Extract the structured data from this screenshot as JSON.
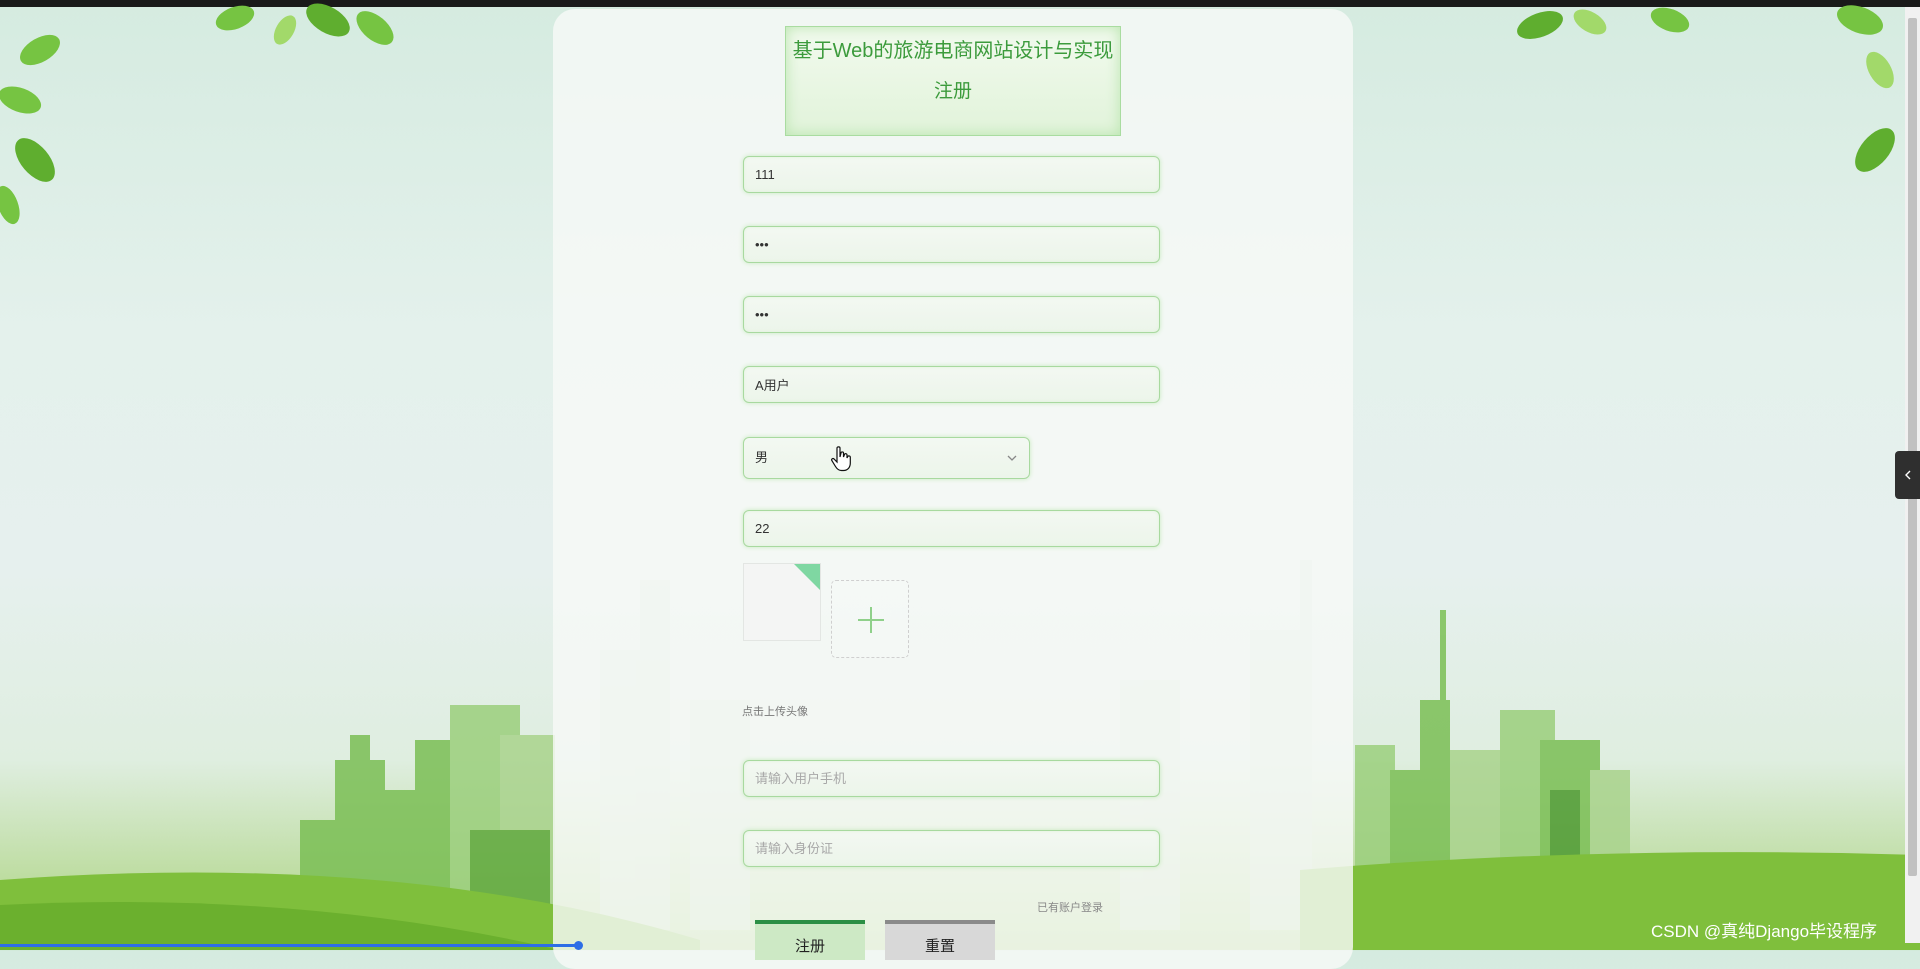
{
  "title": {
    "line1": "基于Web的旅游电商网站设计与实现",
    "line2": "注册"
  },
  "form": {
    "account": {
      "value": "111",
      "placeholder": ""
    },
    "password": {
      "value": "111",
      "placeholder": ""
    },
    "confirm_password": {
      "value": "111",
      "placeholder": ""
    },
    "username": {
      "value": "A用户",
      "placeholder": ""
    },
    "gender": {
      "selected": "男"
    },
    "age": {
      "value": "22",
      "placeholder": ""
    },
    "avatar_tip": "点击上传头像",
    "phone": {
      "value": "",
      "placeholder": "请输入用户手机"
    },
    "id_card": {
      "value": "",
      "placeholder": "请输入身份证"
    }
  },
  "links": {
    "login": "已有账户登录"
  },
  "buttons": {
    "register": "注册",
    "reset": "重置"
  },
  "watermark": "CSDN @真纯Django毕设程序",
  "icons": {
    "upload": "plus-icon",
    "select_arrow": "chevron-down-icon",
    "side_toggle": "chevron-left-icon",
    "cursor": "hand-cursor-icon"
  },
  "colors": {
    "accent_green": "#3c9b3c",
    "register_button": "#cde9c5",
    "reset_button": "#d8d8d8",
    "progress": "#2d6ee6"
  }
}
